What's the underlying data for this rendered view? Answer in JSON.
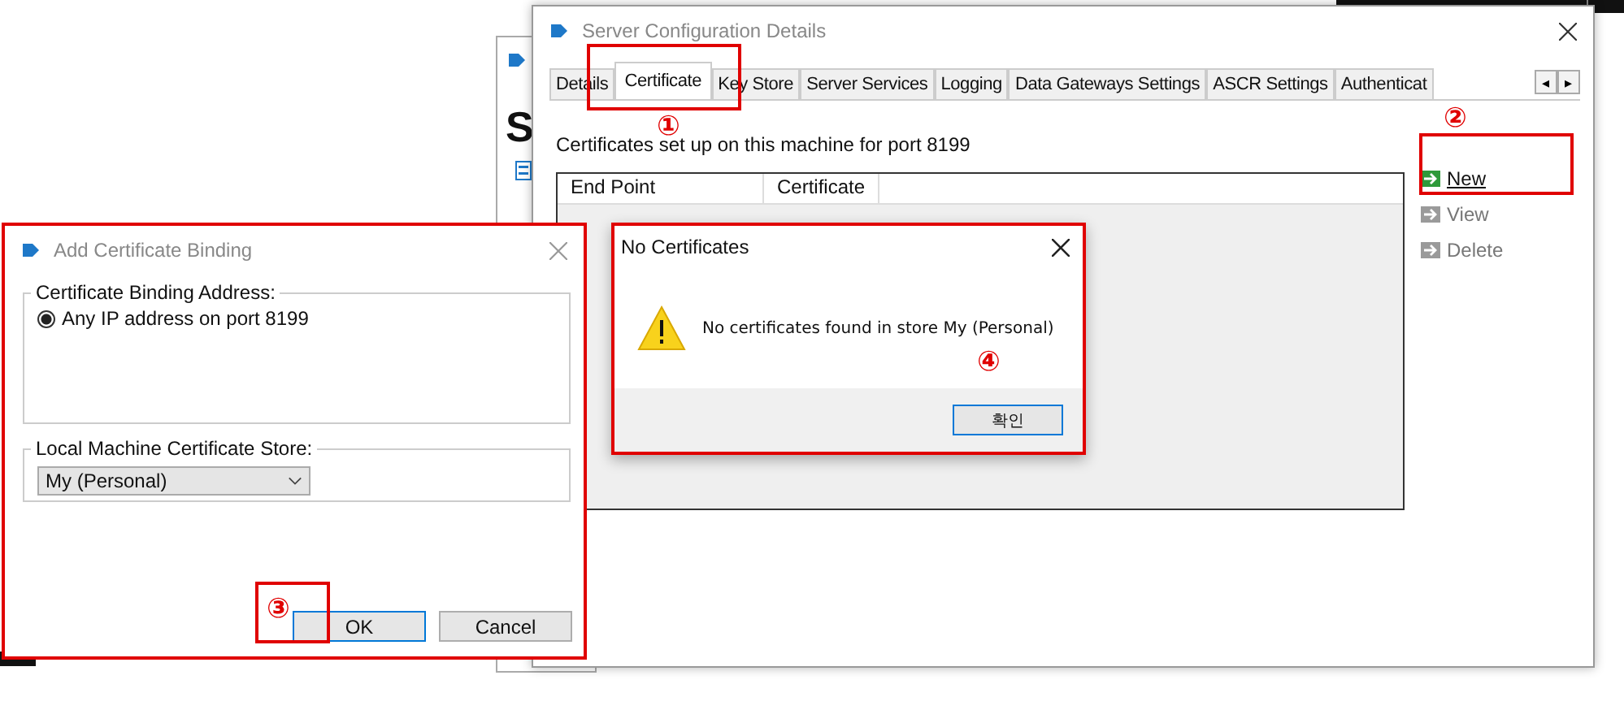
{
  "background_window": {
    "heading": "S"
  },
  "main_window": {
    "title": "Server Configuration Details",
    "tabs": [
      {
        "label": "Details",
        "selected": false
      },
      {
        "label": "Certificate",
        "selected": true
      },
      {
        "label": "Key Store",
        "selected": false
      },
      {
        "label": "Server Services",
        "selected": false
      },
      {
        "label": "Logging",
        "selected": false
      },
      {
        "label": "Data Gateways Settings",
        "selected": false
      },
      {
        "label": "ASCR Settings",
        "selected": false
      },
      {
        "label": "Authenticat",
        "selected": false
      }
    ],
    "tab_scroll": [
      "◂",
      "▸"
    ],
    "description": "Certificates set up on this machine for port 8199",
    "table": {
      "columns": [
        "End Point",
        "Certificate"
      ]
    },
    "actions": [
      {
        "label": "New",
        "disabled": false
      },
      {
        "label": "View",
        "disabled": true
      },
      {
        "label": "Delete",
        "disabled": true
      }
    ]
  },
  "add_binding_dialog": {
    "title": "Add Certificate Binding",
    "address_group": {
      "legend": "Certificate Binding Address:",
      "options": [
        {
          "label": "Any IP address on port 8199",
          "selected": true
        }
      ]
    },
    "store_group": {
      "legend": "Local Machine Certificate Store:",
      "value": "My (Personal)"
    },
    "buttons": [
      {
        "label": "OK",
        "default": true
      },
      {
        "label": "Cancel",
        "default": false
      }
    ]
  },
  "message_box": {
    "title": "No Certificates",
    "message": "No certificates found in store My (Personal)",
    "button": "확인"
  },
  "annotations": [
    {
      "number": "①",
      "kind": "box"
    },
    {
      "number": "②",
      "kind": "box"
    },
    {
      "number": "③",
      "kind": "box"
    },
    {
      "number": "④",
      "kind": "mark"
    }
  ]
}
